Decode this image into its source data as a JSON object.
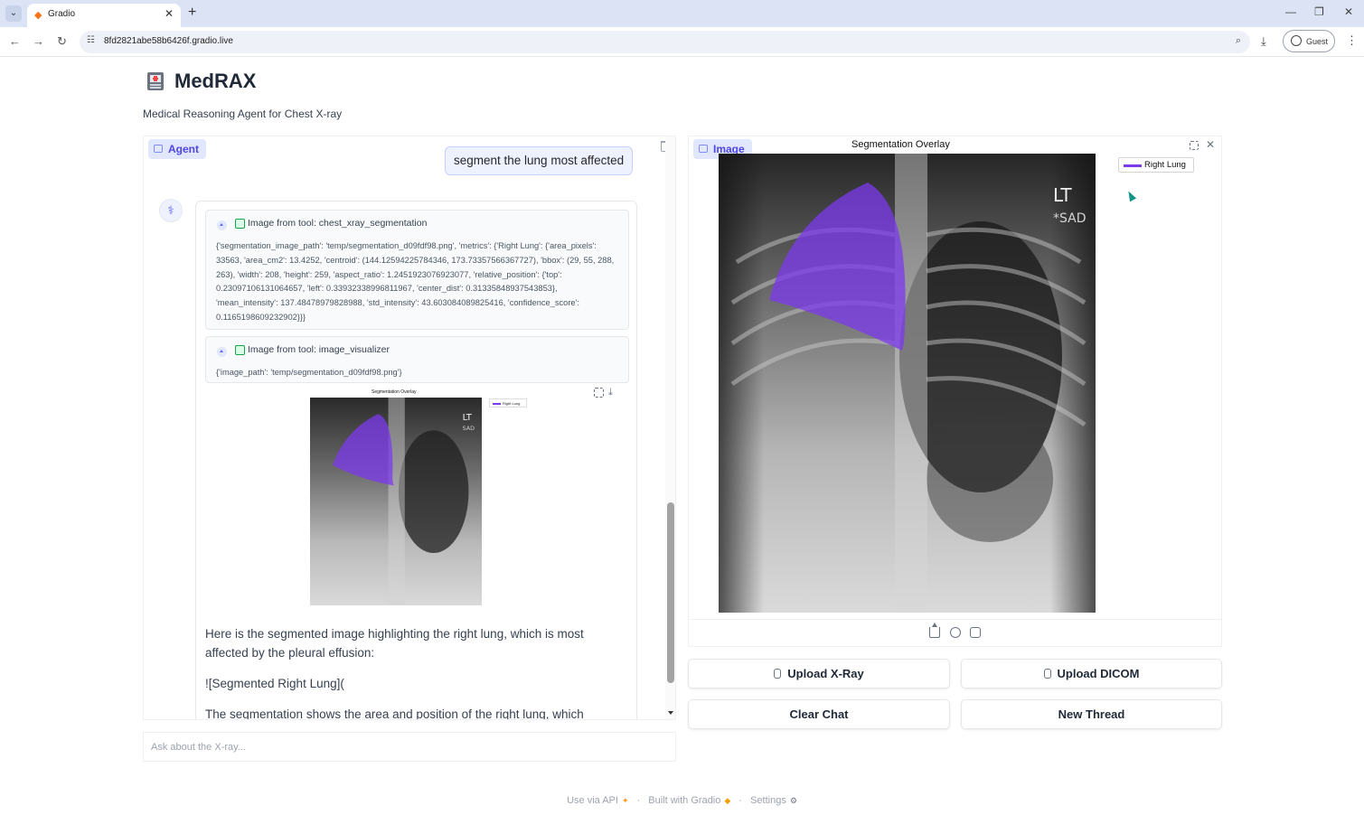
{
  "browser": {
    "tab_title": "Gradio",
    "url": "8fd2821abe58b6426f.gradio.live",
    "profile_label": "Guest"
  },
  "header": {
    "title": "MedRAX",
    "subtitle": "Medical Reasoning Agent for Chest X-ray"
  },
  "chat": {
    "label": "Agent",
    "user_message": "segment the lung most affected",
    "tool_calls": [
      {
        "title": "Image from tool: chest_xray_segmentation",
        "output": "{'segmentation_image_path': 'temp/segmentation_d09fdf98.png', 'metrics': {'Right Lung': {'area_pixels': 33563, 'area_cm2': 13.4252, 'centroid': (144.12594225784346, 173.73357566367727), 'bbox': (29, 55, 288, 263), 'width': 208, 'height': 259, 'aspect_ratio': 1.2451923076923077, 'relative_position': {'top': 0.23097106131064657, 'left': 0.33932338996811967, 'center_dist': 0.31335848937543853}, 'mean_intensity': 137.48478979828988, 'std_intensity': 43.603084089825416, 'confidence_score': 0.1165198609232902}}}"
      },
      {
        "title": "Image from tool: image_visualizer",
        "output": "{'image_path': 'temp/segmentation_d09fdf98.png'}"
      }
    ],
    "inline_figure": {
      "title": "Segmentation Overlay",
      "legend": "Right Lung",
      "marker_lt": "LT",
      "marker_sad": "SAD"
    },
    "bot_paragraphs": [
      "Here is the segmented image highlighting the right lung, which is most affected by the pleural effusion:",
      "![Segmented Right Lung](",
      "The segmentation shows the area and position of the right lung, which"
    ],
    "input_placeholder": "Ask about the X-ray..."
  },
  "image_panel": {
    "label": "Image",
    "figure_title": "Segmentation Overlay",
    "legend": "Right Lung",
    "marker_lt": "LT",
    "marker_sad": "*SAD",
    "overlay_color": "#7c3aed"
  },
  "buttons": {
    "upload_xray": "Upload X-Ray",
    "upload_dicom": "Upload DICOM",
    "clear_chat": "Clear Chat",
    "new_thread": "New Thread"
  },
  "footer": {
    "api": "Use via API",
    "built": "Built with Gradio",
    "settings": "Settings"
  }
}
